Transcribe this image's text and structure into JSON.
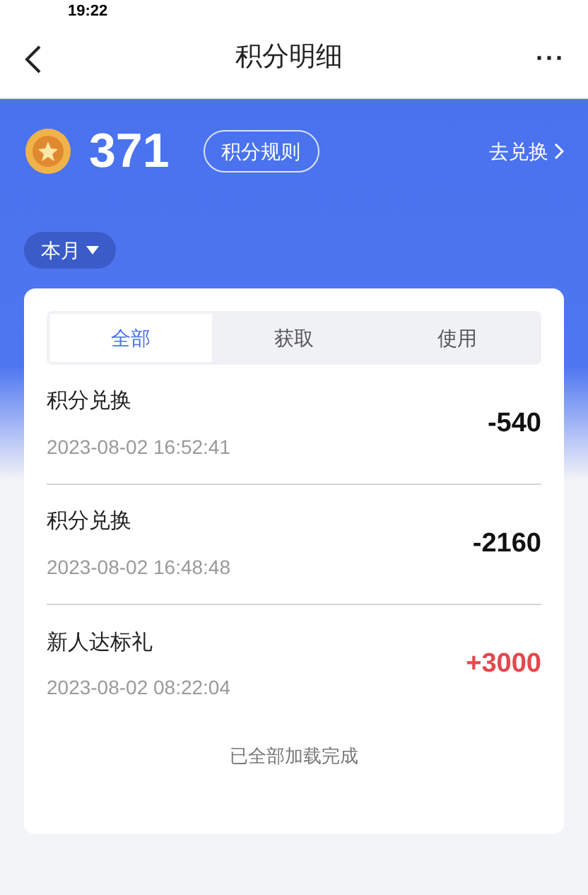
{
  "status_bar": {
    "time": "19:22"
  },
  "nav": {
    "title": "积分明细",
    "more": "···"
  },
  "summary": {
    "points": "371",
    "rules_button": "积分规则",
    "exchange_link": "去兑换"
  },
  "filter": {
    "label": "本月"
  },
  "tabs": [
    {
      "label": "全部",
      "selected": true
    },
    {
      "label": "获取",
      "selected": false
    },
    {
      "label": "使用",
      "selected": false
    }
  ],
  "records": [
    {
      "title": "积分兑换",
      "time": "2023-08-02 16:52:41",
      "amount": "-540",
      "color": "#111111"
    },
    {
      "title": "积分兑换",
      "time": "2023-08-02 16:48:48",
      "amount": "-2160",
      "color": "#111111"
    },
    {
      "title": "新人达标礼",
      "time": "2023-08-02 08:22:04",
      "amount": "+3000",
      "color": "#e5484d"
    }
  ],
  "footer": "已全部加载完成"
}
